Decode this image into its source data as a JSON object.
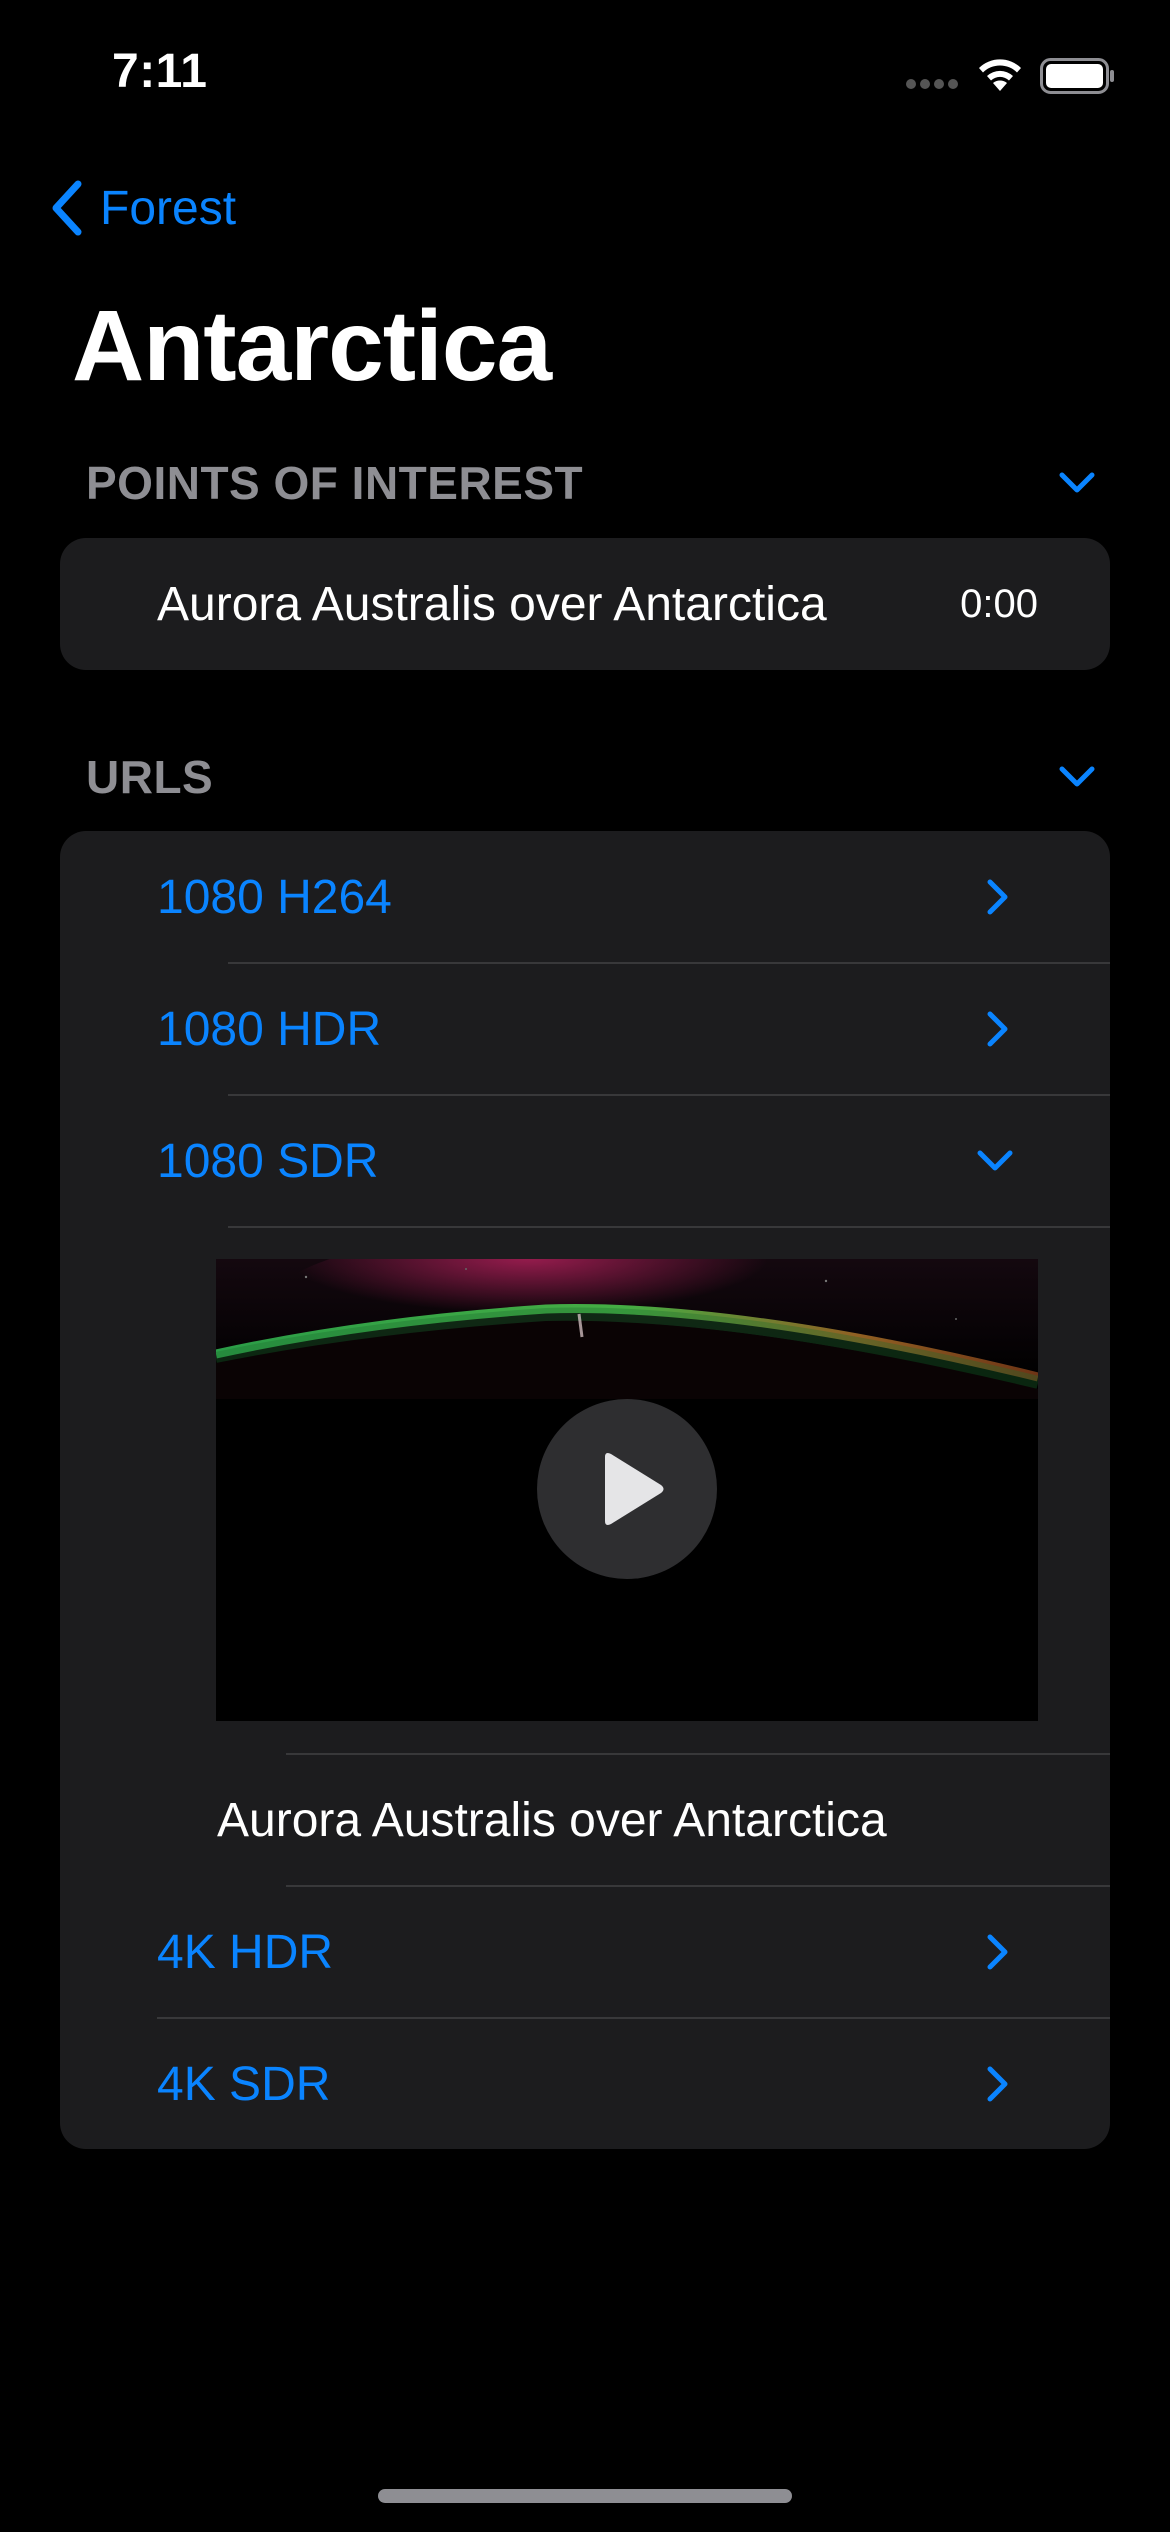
{
  "status_bar": {
    "time": "7:11"
  },
  "nav": {
    "back_label": "Forest",
    "title": "Antarctica"
  },
  "points_of_interest": {
    "header": "POINTS OF INTEREST",
    "items": [
      {
        "title": "Aurora Australis over Antarctica",
        "time": "0:00"
      }
    ]
  },
  "urls": {
    "header": "URLS",
    "items": [
      {
        "label": "1080 H264",
        "state": "collapsed"
      },
      {
        "label": "1080 HDR",
        "state": "collapsed"
      },
      {
        "label": "1080 SDR",
        "state": "expanded"
      },
      {
        "label": "4K HDR",
        "state": "collapsed"
      },
      {
        "label": "4K SDR",
        "state": "collapsed"
      }
    ],
    "expanded_video": {
      "caption": "Aurora Australis over Antarctica"
    }
  },
  "colors": {
    "accent": "#0a84ff",
    "background": "#000000",
    "card": "#1c1c1e",
    "secondary_text": "#8e8e93",
    "separator": "#38383a"
  },
  "icons": {
    "back": "chevron-left-icon",
    "section_toggle": "chevron-down-icon",
    "row_disclosure": "chevron-right-icon",
    "play": "play-icon",
    "wifi": "wifi-icon",
    "battery": "battery-icon"
  }
}
